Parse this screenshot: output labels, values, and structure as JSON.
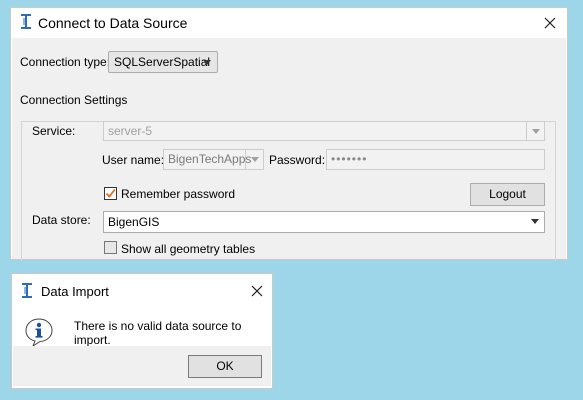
{
  "connect_dialog": {
    "title": "Connect to Data Source",
    "connection_type_label": "Connection type:",
    "connection_type_value": "SQLServerSpatial",
    "settings_group_label": "Connection Settings",
    "service_label": "Service:",
    "service_value": "server-5",
    "user_name_label": "User name:",
    "user_name_value": "BigenTechApps",
    "password_label": "Password:",
    "password_value": "•••••••",
    "remember_password_label": "Remember password",
    "remember_password_checked": true,
    "logout_label": "Logout",
    "data_store_label": "Data store:",
    "data_store_value": "BigenGIS",
    "show_all_tables_label": "Show all geometry tables",
    "show_all_tables_checked": false
  },
  "import_dialog": {
    "title": "Data Import",
    "message": "There is no valid data source to import.",
    "ok_label": "OK"
  },
  "colors": {
    "desktop": "#9dd6e8",
    "dialog_body": "#f0f0f0",
    "checkmark": "#e06c1a",
    "info_icon": "#1f4e9c"
  },
  "icons": [
    "app-icon",
    "close-icon",
    "info-icon",
    "checkmark-icon",
    "dropdown-arrow-icon"
  ]
}
